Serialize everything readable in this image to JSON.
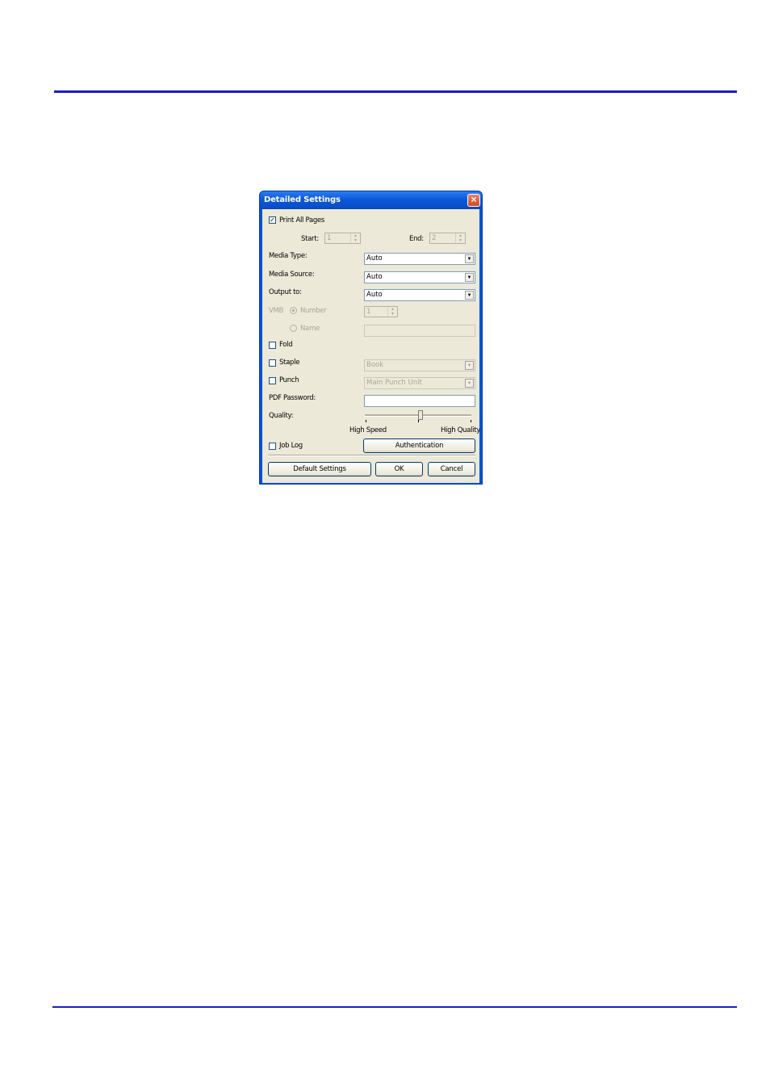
{
  "dialog": {
    "title": "Detailed Settings",
    "close_label": "×",
    "print_all_pages": {
      "label": "Print All Pages",
      "checked": true,
      "check_mark": "✓"
    },
    "start": {
      "label": "Start:",
      "value": "1"
    },
    "end": {
      "label": "End:",
      "value": "2"
    },
    "media_type": {
      "label": "Media Type:",
      "value": "Auto"
    },
    "media_source": {
      "label": "Media Source:",
      "value": "Auto"
    },
    "output_to": {
      "label": "Output to:",
      "value": "Auto"
    },
    "vmb": {
      "label": "VMB",
      "number_label": "Number",
      "number_value": "1",
      "name_label": "Name",
      "selected": "number"
    },
    "fold": {
      "label": "Fold",
      "checked": false
    },
    "staple": {
      "label": "Staple",
      "checked": false,
      "value": "Book"
    },
    "punch": {
      "label": "Punch",
      "checked": false,
      "value": "Main Punch Unit"
    },
    "pdf_password": {
      "label": "PDF Password:",
      "value": ""
    },
    "quality": {
      "label": "Quality:",
      "min_label": "High Speed",
      "max_label": "High Quality",
      "level": 0.5
    },
    "job_log": {
      "label": "Job Log",
      "checked": false
    },
    "authentication_label": "Authentication",
    "default_settings_label": "Default Settings",
    "ok_label": "OK",
    "cancel_label": "Cancel"
  },
  "colors": {
    "rule": "#1c1cc8",
    "titlebar": "#0a52d6",
    "dialog_face": "#ece9d8"
  }
}
